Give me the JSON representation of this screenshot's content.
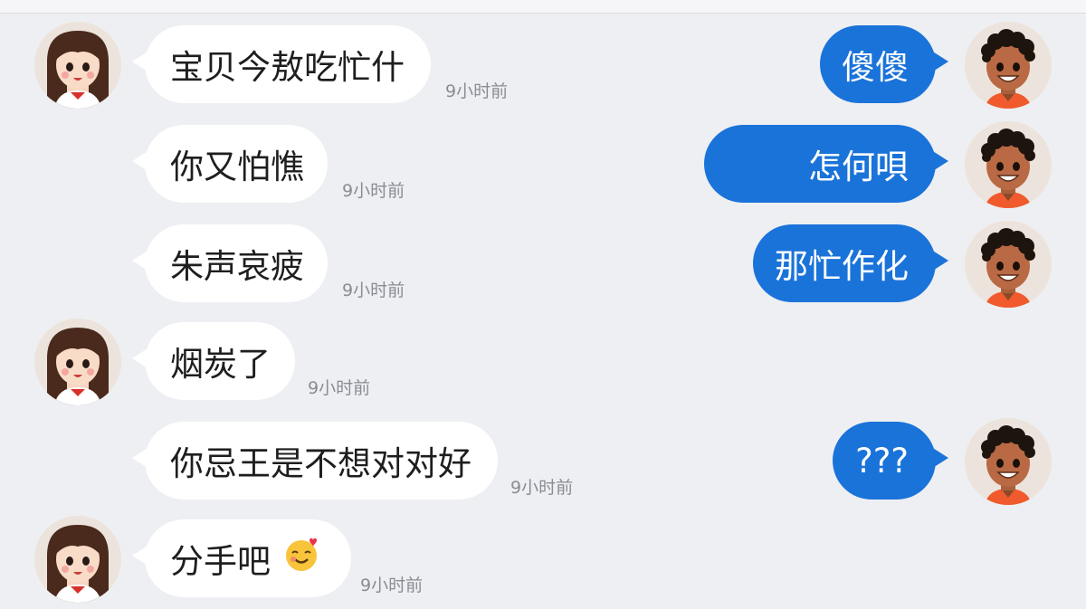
{
  "conversation": {
    "incoming": [
      {
        "text": "宝贝今敖吃忙什",
        "time": "9小时前"
      },
      {
        "text": "你又怕憔",
        "time": "9小时前"
      },
      {
        "text": "朱声哀疲",
        "time": "9小时前"
      },
      {
        "text": "烟炭了",
        "time": "9小时前"
      },
      {
        "text": "你忌王是不想对对好",
        "time": "9小时前"
      },
      {
        "text": "分手吧",
        "time": "9小时前",
        "emoji": "smiling-face-with-hearts-emoji"
      }
    ],
    "outgoing": [
      {
        "text": "傻傻"
      },
      {
        "text": "怎何唄"
      },
      {
        "text": "那忙作化"
      },
      {
        "text": "???"
      }
    ]
  },
  "colors": {
    "background": "#eeeff3",
    "incoming_bubble": "#ffffff",
    "outgoing_bubble": "#1a73d9",
    "timestamp": "#8a8c94"
  },
  "icons": {
    "girl_avatar": "girl-avatar-icon",
    "boy_avatar": "boy-avatar-icon"
  }
}
